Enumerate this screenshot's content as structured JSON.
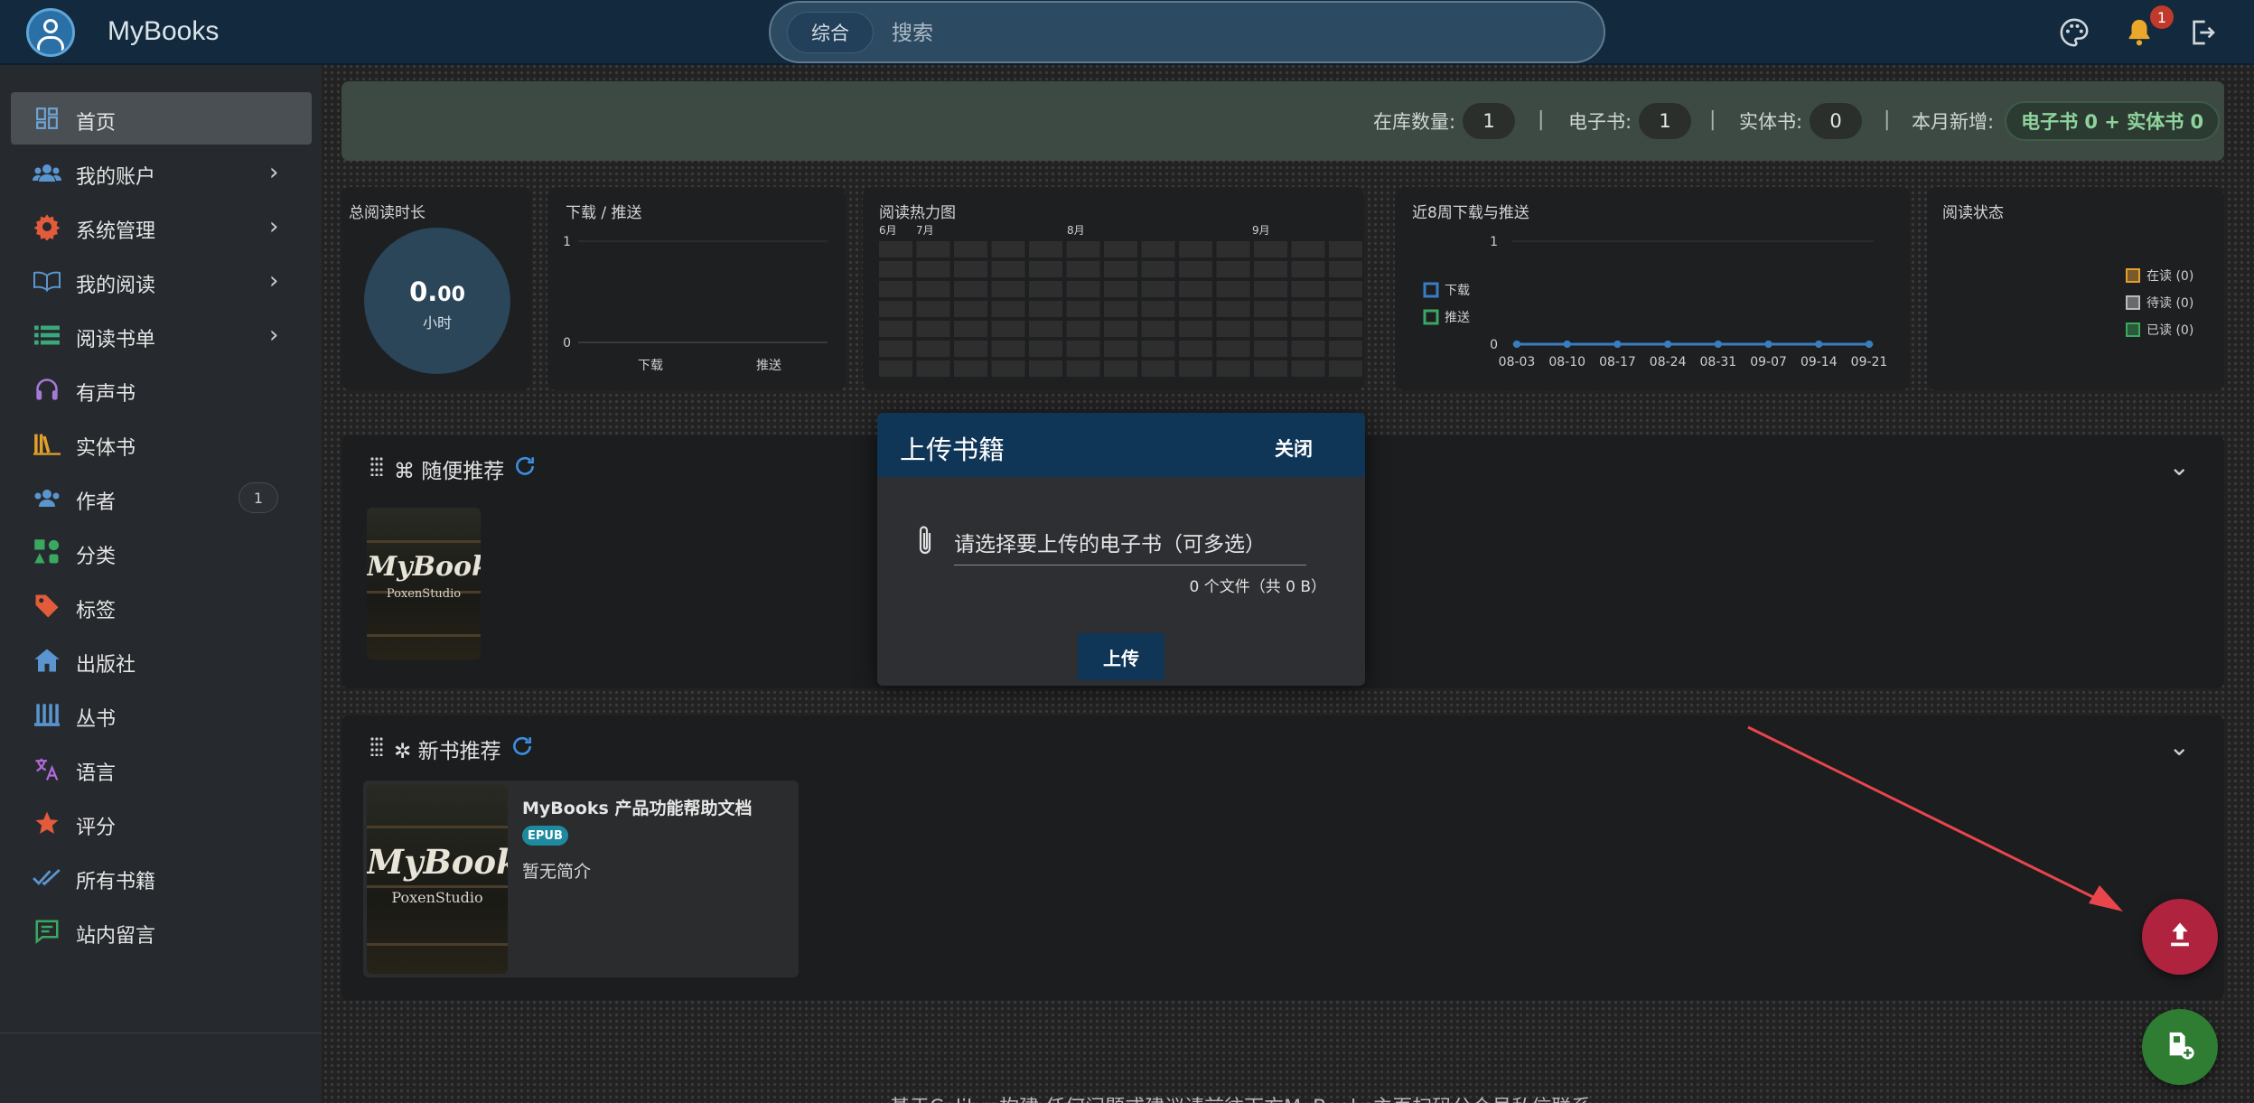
{
  "header": {
    "app_name": "MyBooks",
    "search_tab": "综合",
    "search_placeholder": "搜索",
    "notification_count": "1"
  },
  "sidebar": {
    "items": [
      {
        "label": "首页",
        "icon": "dashboard-icon"
      },
      {
        "label": "我的账户",
        "icon": "users-icon"
      },
      {
        "label": "系统管理",
        "icon": "gear-icon"
      },
      {
        "label": "我的阅读",
        "icon": "open-book-icon"
      },
      {
        "label": "阅读书单",
        "icon": "list-icon"
      },
      {
        "label": "有声书",
        "icon": "headphones-icon"
      },
      {
        "label": "实体书",
        "icon": "bookshelf-icon"
      },
      {
        "label": "作者",
        "icon": "users-icon",
        "count": "1"
      },
      {
        "label": "分类",
        "icon": "shapes-icon"
      },
      {
        "label": "标签",
        "icon": "tag-icon"
      },
      {
        "label": "出版社",
        "icon": "publisher-icon"
      },
      {
        "label": "丛书",
        "icon": "series-icon"
      },
      {
        "label": "语言",
        "icon": "translate-icon"
      },
      {
        "label": "评分",
        "icon": "star-icon"
      },
      {
        "label": "所有书籍",
        "icon": "double-check-icon"
      },
      {
        "label": "站内留言",
        "icon": "message-icon"
      }
    ],
    "logout_label": "退出"
  },
  "stats": {
    "in_library_label": "在库数量:",
    "in_library_value": "1",
    "ebook_label": "电子书:",
    "ebook_value": "1",
    "physical_label": "实体书:",
    "physical_value": "0",
    "monthly_new_label": "本月新增:",
    "monthly_new_value": "电子书 0 + 实体书 0",
    "separator": "|"
  },
  "cards": {
    "reading_time": {
      "title": "总阅读时长",
      "value_int": "0.",
      "value_dec": "00",
      "unit": "小时"
    },
    "download_push": {
      "title": "下载 / 推送",
      "y_max": "1",
      "y_min": "0",
      "x1": "下载",
      "x2": "推送"
    },
    "heatmap": {
      "title": "阅读热力图",
      "months": [
        "6月",
        "7月",
        "8月",
        "9月"
      ]
    },
    "weekly": {
      "title": "近8周下载与推送",
      "y_max": "1",
      "y_min": "0",
      "legend_download": "下载",
      "legend_push": "推送"
    },
    "reading_status": {
      "title": "阅读状态",
      "legend": [
        "在读 (0)",
        "待读 (0)",
        "已读 (0)"
      ]
    }
  },
  "chart_data": [
    {
      "type": "bar",
      "title": "下载 / 推送",
      "categories": [
        "下载",
        "推送"
      ],
      "values": [
        0,
        0
      ],
      "ylim": [
        0,
        1
      ]
    },
    {
      "type": "line",
      "title": "近8周下载与推送",
      "x": [
        "08-03",
        "08-10",
        "08-17",
        "08-24",
        "08-31",
        "09-07",
        "09-14",
        "09-21"
      ],
      "series": [
        {
          "name": "下载",
          "values": [
            0,
            0,
            0,
            0,
            0,
            0,
            0,
            0
          ]
        },
        {
          "name": "推送",
          "values": [
            0,
            0,
            0,
            0,
            0,
            0,
            0,
            0
          ]
        }
      ],
      "ylim": [
        0,
        1
      ],
      "legend": "left"
    }
  ],
  "panels": {
    "random": {
      "title": "⌘ 随便推荐"
    },
    "new_books": {
      "title": "✲ 新书推荐"
    }
  },
  "book": {
    "title": "MyBooks 产品功能帮助文档",
    "format": "EPUB",
    "summary": "暂无简介",
    "cover_title": "MyBooks",
    "cover_sub": "PoxenStudio"
  },
  "modal": {
    "title": "上传书籍",
    "close_label": "关闭",
    "file_label": "请选择要上传的电子书（可多选）",
    "file_count": "0 个文件（共 0 B）",
    "upload_label": "上传"
  },
  "footer": {
    "text": "基于Calibre构建 任何问题或建议请前往下方MyBooks主页扫码公众号私信联系"
  },
  "colors": {
    "accent": "#0f3557",
    "upload_fab": "#b0233f",
    "add_fab": "#2e7d32",
    "annotation_arrow": "#e8454d"
  }
}
